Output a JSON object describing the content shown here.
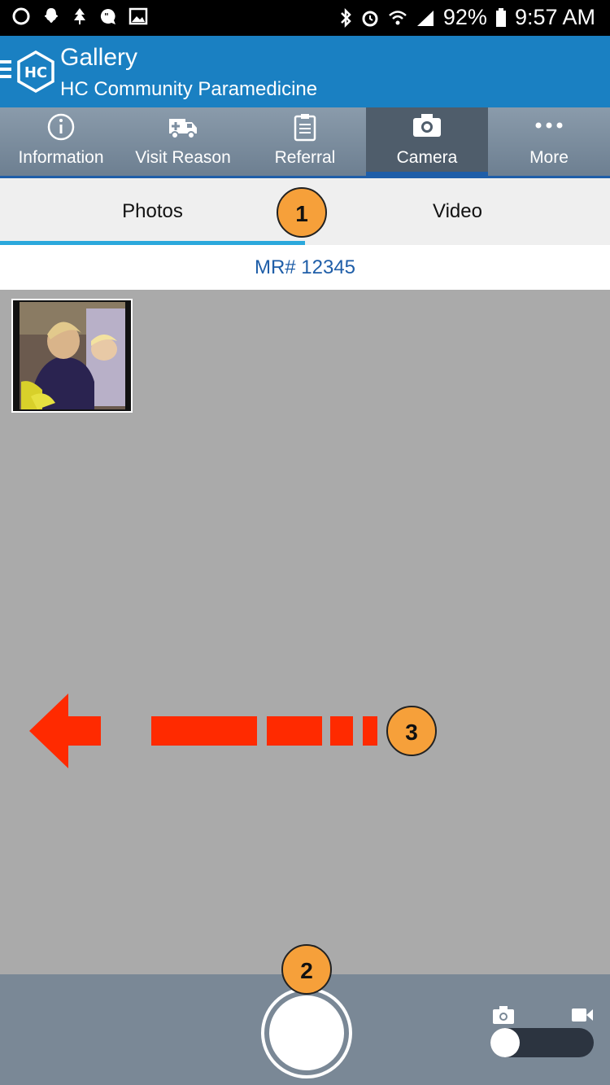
{
  "status_bar": {
    "left_icons": [
      "circle-icon",
      "ghost-icon",
      "tree-icon",
      "chat-icon",
      "image-icon"
    ],
    "right_icons": [
      "bluetooth-icon",
      "alarm-icon",
      "wifi-icon",
      "signal-icon",
      "battery-icon"
    ],
    "battery": "92%",
    "time": "9:57 AM"
  },
  "app_bar": {
    "title": "Gallery",
    "subtitle": "HC Community Paramedicine",
    "logo_text": "HC"
  },
  "nav": {
    "items": [
      {
        "label": "Information",
        "icon": "info-icon"
      },
      {
        "label": "Visit Reason",
        "icon": "ambulance-icon"
      },
      {
        "label": "Referral",
        "icon": "clipboard-icon"
      },
      {
        "label": "Camera",
        "icon": "camera-icon"
      },
      {
        "label": "More",
        "icon": "more-icon"
      }
    ],
    "active": "Camera"
  },
  "subtabs": {
    "photos": "Photos",
    "video": "Video"
  },
  "mr_label": "MR# 12345",
  "callouts": {
    "one": "1",
    "two": "2",
    "three": "3"
  },
  "colors": {
    "app_bar": "#1a80c2",
    "accent": "#2ba8dc",
    "callout": "#f6a03a",
    "arrow": "#ff2a00"
  }
}
